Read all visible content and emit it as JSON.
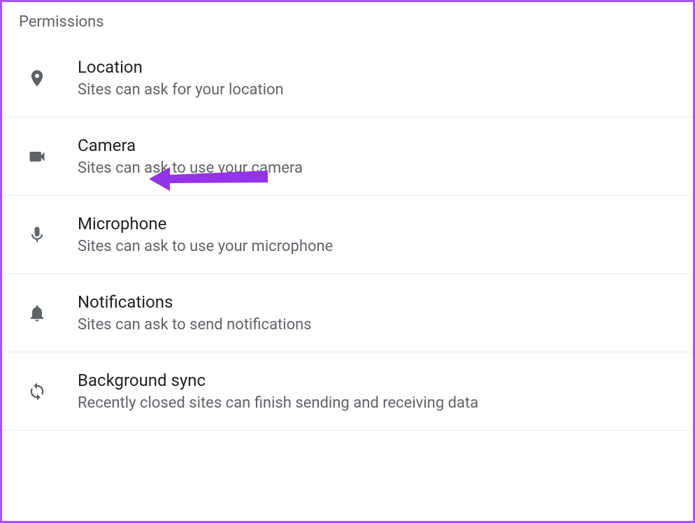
{
  "section": {
    "title": "Permissions"
  },
  "items": [
    {
      "icon": "location",
      "title": "Location",
      "subtitle": "Sites can ask for your location"
    },
    {
      "icon": "camera",
      "title": "Camera",
      "subtitle": "Sites can ask to use your camera"
    },
    {
      "icon": "microphone",
      "title": "Microphone",
      "subtitle": "Sites can ask to use your microphone"
    },
    {
      "icon": "notifications",
      "title": "Notifications",
      "subtitle": "Sites can ask to send notifications"
    },
    {
      "icon": "sync",
      "title": "Background sync",
      "subtitle": "Recently closed sites can finish sending and receiving data"
    }
  ],
  "annotation": {
    "target": "camera",
    "color": "#9333ea"
  }
}
